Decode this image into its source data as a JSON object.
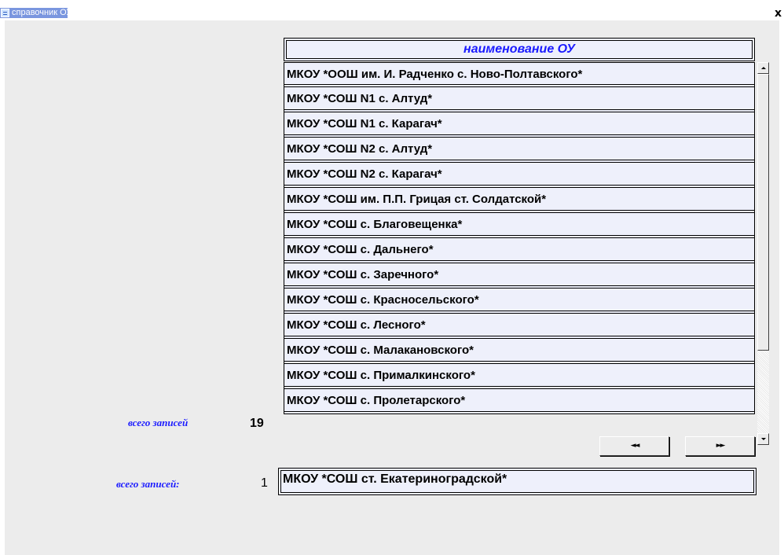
{
  "window": {
    "title": "справочник ОУ",
    "close_label": "x"
  },
  "list": {
    "header": "наименование ОУ",
    "rows": [
      "МКОУ *ООШ им. И. Радченко с. Ново-Полтавского*",
      "МКОУ *СОШ N1 с. Алтуд*",
      "МКОУ *СОШ N1 с. Карагач*",
      "МКОУ *СОШ N2 с. Алтуд*",
      "МКОУ *СОШ N2 с. Карагач*",
      "МКОУ *СОШ им. П.П. Грицая ст. Солдатской*",
      "МКОУ *СОШ с. Благовещенка*",
      "МКОУ *СОШ с. Дальнего*",
      "МКОУ *СОШ с. Заречного*",
      "МКОУ *СОШ с. Красносельского*",
      "МКОУ *СОШ с. Лесного*",
      "МКОУ *СОШ с. Малакановского*",
      "МКОУ *СОШ с. Прималкинского*",
      "МКОУ *СОШ с. Пролетарского*"
    ]
  },
  "totals": {
    "label_all": "всего записей",
    "value_all": "19",
    "label_selected": "всего записей:",
    "value_selected": "1"
  },
  "navigation": {
    "prev_label": "◄◄",
    "next_label": "►►"
  },
  "current": {
    "value": "МКОУ *СОШ ст. Екатериноградской*"
  },
  "icons": {
    "title_icon": "form-icon",
    "scroll_up": "arrow-up-icon",
    "scroll_down": "arrow-down-icon"
  }
}
